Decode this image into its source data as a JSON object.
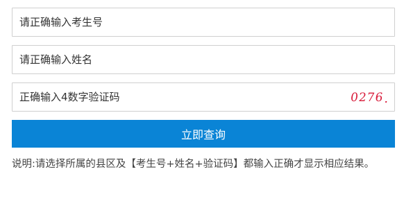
{
  "form": {
    "exam_number": {
      "value": "",
      "placeholder": "请正确输入考生号"
    },
    "name": {
      "value": "",
      "placeholder": "请正确输入姓名"
    },
    "captcha_input": {
      "value": "",
      "placeholder": "正确输入4数字验证码"
    },
    "captcha_code": "0276",
    "submit_label": "立即查询"
  },
  "note": "说明:请选择所属的县区及【考生号+姓名+验证码】都输入正确才显示相应结果。",
  "colors": {
    "button_bg": "#0a84d6",
    "button_text": "#ffffff",
    "captcha_text": "#d81b3a",
    "border": "#cfcfcf"
  }
}
